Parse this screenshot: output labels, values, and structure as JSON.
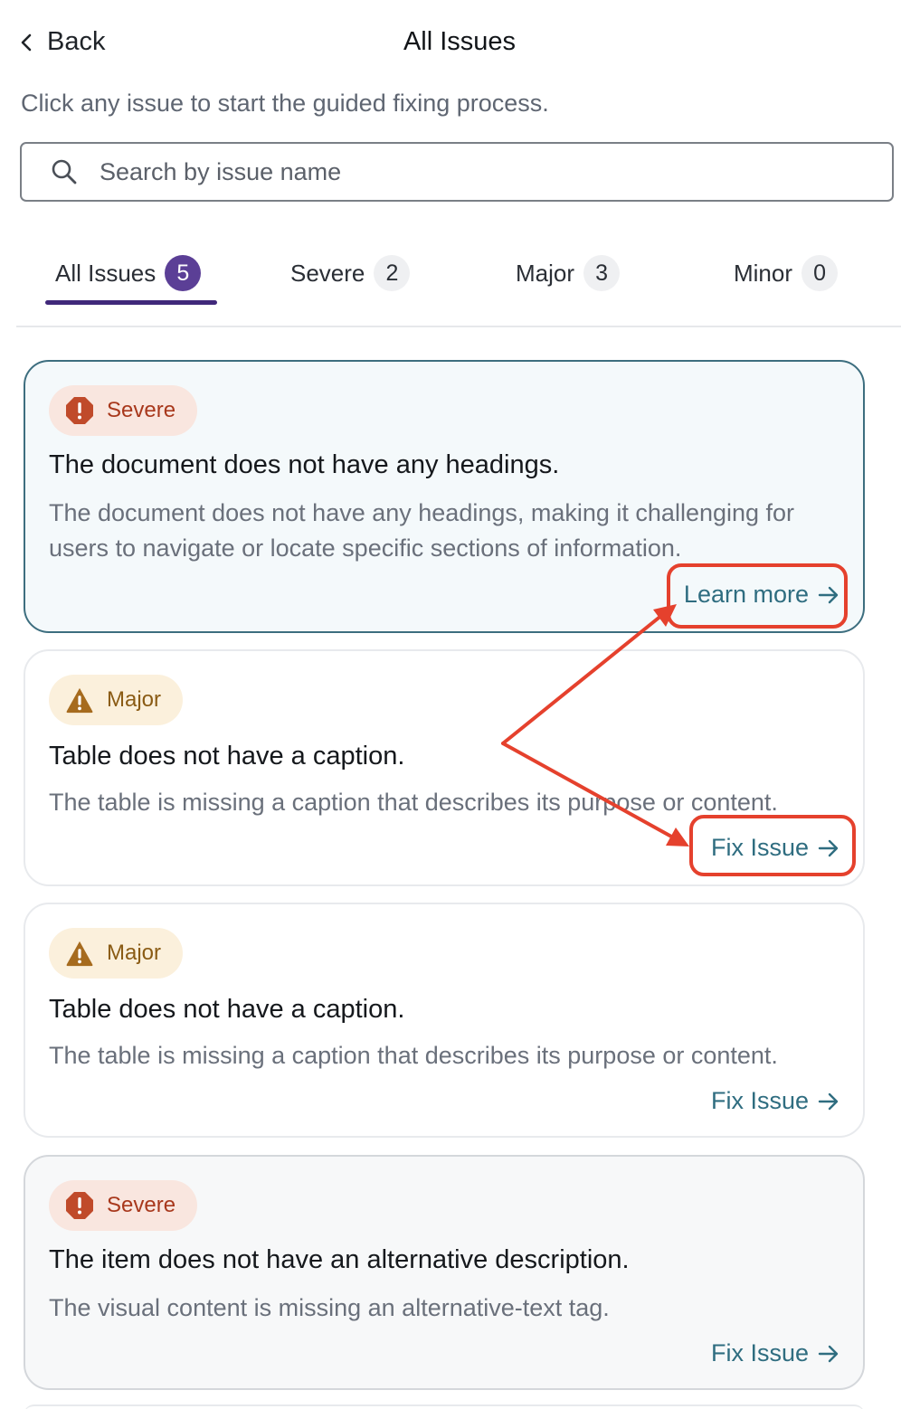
{
  "header": {
    "back_label": "Back",
    "title": "All Issues",
    "subtitle": "Click any issue to start the guided fixing process."
  },
  "search": {
    "placeholder": "Search by issue name",
    "value": ""
  },
  "tabs": [
    {
      "label": "All Issues",
      "count": "5",
      "active": true
    },
    {
      "label": "Severe",
      "count": "2",
      "active": false
    },
    {
      "label": "Major",
      "count": "3",
      "active": false
    },
    {
      "label": "Minor",
      "count": "0",
      "active": false
    }
  ],
  "issues": [
    {
      "severity": "Severe",
      "title": "The document does not have any headings.",
      "description": "The document does not have any headings, making it challenging for users to navigate or locate specific sections of information.",
      "action": "Learn more"
    },
    {
      "severity": "Major",
      "title": "Table does not have a caption.",
      "description": "The table is missing a caption that describes its purpose or content.",
      "action": "Fix Issue"
    },
    {
      "severity": "Major",
      "title": "Table does not have a caption.",
      "description": "The table is missing a caption that describes its purpose or content.",
      "action": "Fix Issue"
    },
    {
      "severity": "Severe",
      "title": "The item does not have an alternative description.",
      "description": "The visual content is missing an alternative-text tag.",
      "action": "Fix Issue"
    }
  ],
  "colors": {
    "accent": "#2f6d80",
    "tab_active": "#40287a",
    "severe": "#a8381c",
    "major": "#8a5b14",
    "annotation": "#e5412d"
  },
  "icons": {
    "back": "chevron-left-icon",
    "search": "search-icon",
    "severe": "octagon-alert-icon",
    "major": "triangle-warning-icon",
    "link": "arrow-right-icon"
  }
}
